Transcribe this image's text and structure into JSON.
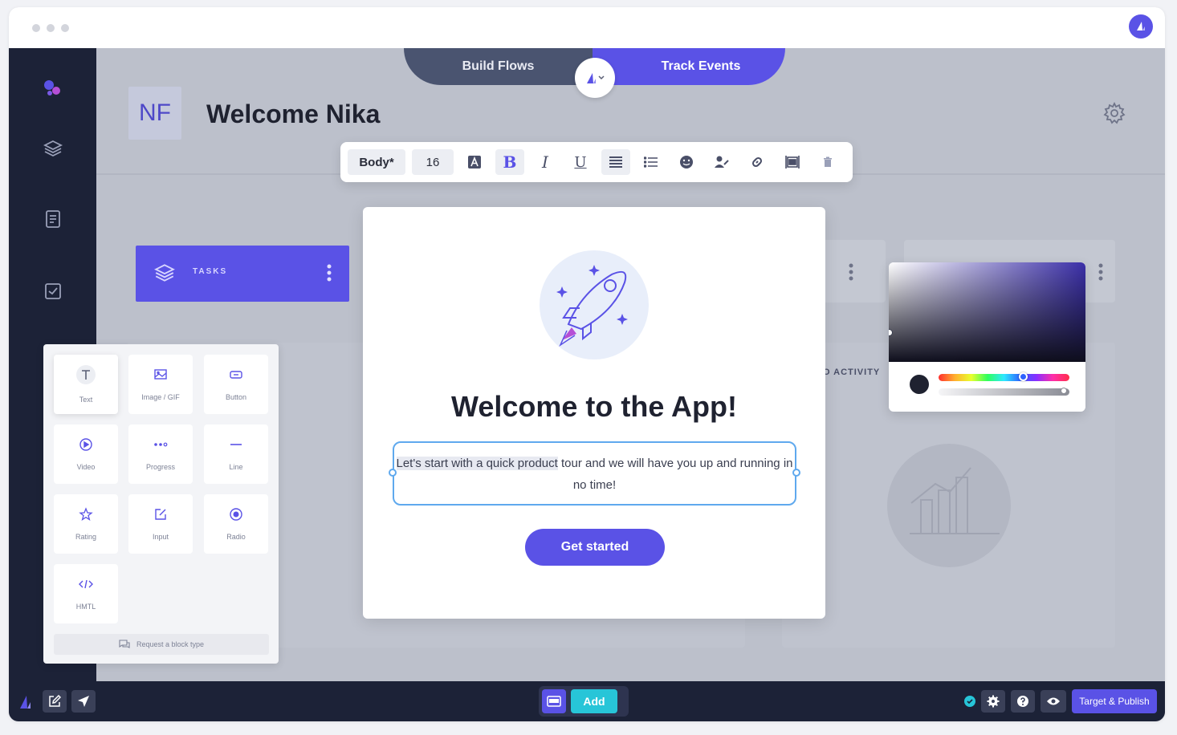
{
  "modes": {
    "build": "Build Flows",
    "track": "Track Events"
  },
  "header": {
    "avatar_initials": "NF",
    "title": "Welcome Nika"
  },
  "toolbar": {
    "style": "Body*",
    "size": "16",
    "buttons": [
      "text-color-icon",
      "bold-icon",
      "italic-icon",
      "underline-icon",
      "align-icon",
      "list-icon",
      "emoji-icon",
      "personalize-icon",
      "link-icon",
      "embed-icon",
      "delete-icon"
    ]
  },
  "tasks": {
    "label": "TASKS"
  },
  "activity": {
    "label": "NO ACTIVITY"
  },
  "blocks": {
    "items": [
      {
        "label": "Text",
        "icon": "text-icon"
      },
      {
        "label": "Image / GIF",
        "icon": "image-icon"
      },
      {
        "label": "Button",
        "icon": "button-icon"
      },
      {
        "label": "Video",
        "icon": "video-icon"
      },
      {
        "label": "Progress",
        "icon": "progress-icon"
      },
      {
        "label": "Line",
        "icon": "line-icon"
      },
      {
        "label": "Rating",
        "icon": "star-icon"
      },
      {
        "label": "Input",
        "icon": "input-icon"
      },
      {
        "label": "Radio",
        "icon": "radio-icon"
      },
      {
        "label": "HMTL",
        "icon": "code-icon"
      }
    ],
    "request": "Request a block type"
  },
  "modal": {
    "title": "Welcome to the App!",
    "text_highlight": "Let's start with a quick product",
    "text_rest": " tour and we will have you up and running in no time!",
    "cta": "Get started"
  },
  "bottombar": {
    "add": "Add",
    "publish": "Target & Publish"
  },
  "colors": {
    "accent": "#5a52e6",
    "sidebar": "#1c2237",
    "teal": "#27c5d8"
  }
}
